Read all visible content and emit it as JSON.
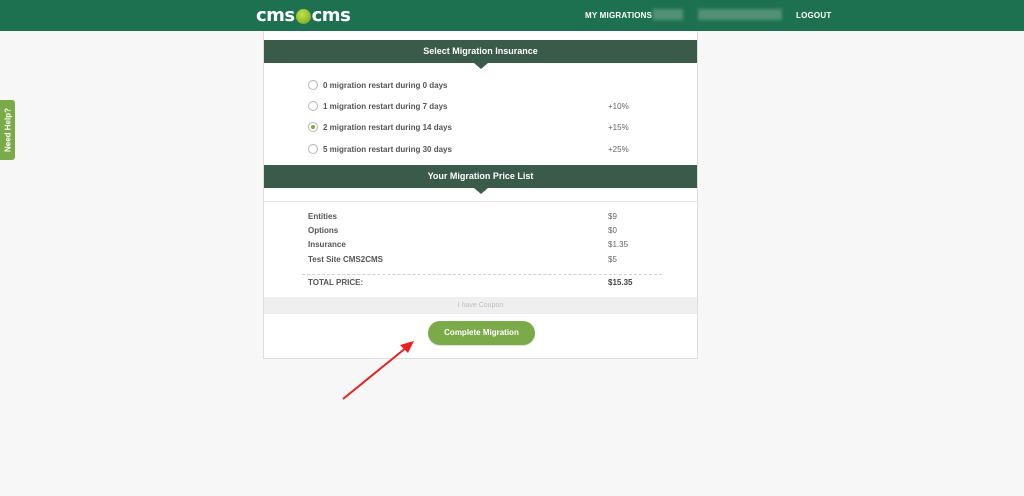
{
  "header": {
    "logo_left": "cms",
    "logo_right": "cms",
    "nav": {
      "my_migrations": "MY MIGRATIONS",
      "logout": "LOGOUT"
    }
  },
  "help_tab": {
    "label": "Need Help?"
  },
  "insurance": {
    "title": "Select Migration Insurance",
    "options": [
      {
        "label": "0 migration restart during 0 days",
        "surcharge": "",
        "selected": false
      },
      {
        "label": "1 migration restart during 7 days",
        "surcharge": "+10%",
        "selected": false
      },
      {
        "label": "2 migration restart during 14 days",
        "surcharge": "+15%",
        "selected": true
      },
      {
        "label": "5 migration restart during 30 days",
        "surcharge": "+25%",
        "selected": false
      }
    ]
  },
  "price_list": {
    "title": "Your Migration Price List",
    "items": [
      {
        "label": "Entities",
        "amount": "$9"
      },
      {
        "label": "Options",
        "amount": "$0"
      },
      {
        "label": "Insurance",
        "amount": "$1.35"
      },
      {
        "label": "Test Site CMS2CMS",
        "amount": "$5"
      }
    ],
    "total_label": "TOTAL PRICE:",
    "total_amount": "$15.35"
  },
  "coupon_label": "I have Coupon",
  "complete_button": "Complete Migration",
  "colors": {
    "header_bg": "#1e7150",
    "section_bg": "#3a5a4a",
    "accent": "#7aab48",
    "annotation_arrow": "#e8211f"
  }
}
